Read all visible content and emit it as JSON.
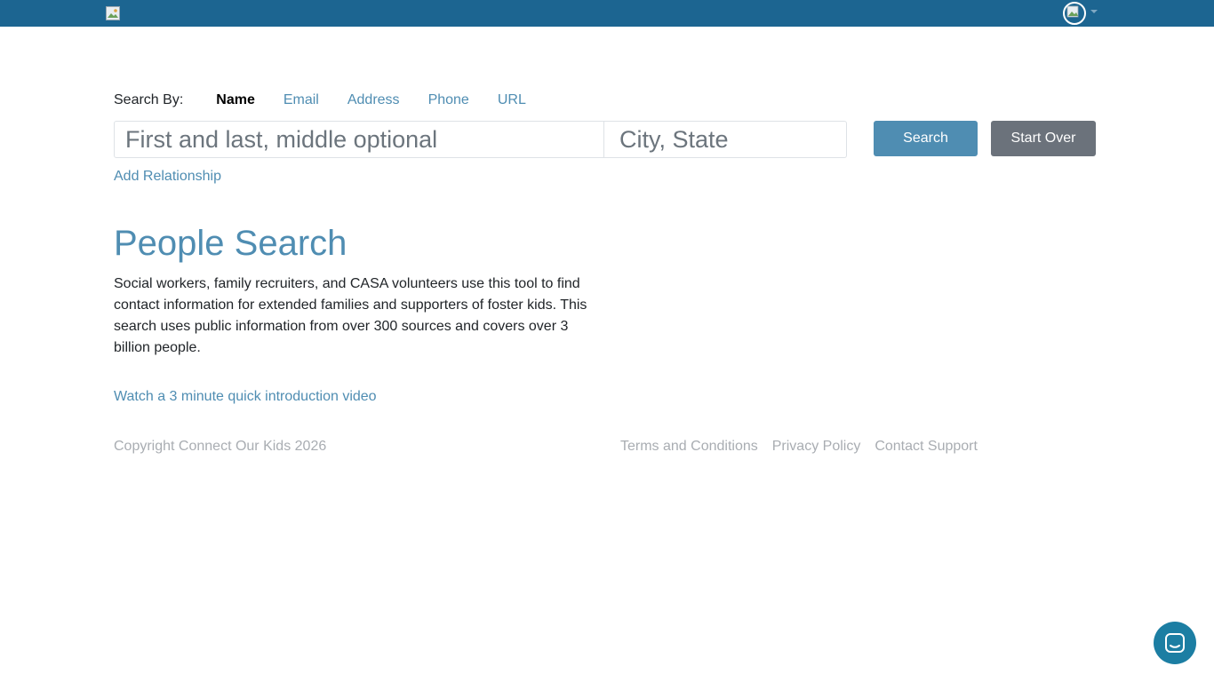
{
  "header": {
    "logo_icon": "broken-image-icon",
    "avatar_icon": "user-avatar-icon",
    "menu_caret_icon": "chevron-down-icon"
  },
  "search_by": {
    "label": "Search By:",
    "tabs": [
      {
        "label": "Name",
        "active": true
      },
      {
        "label": "Email",
        "active": false
      },
      {
        "label": "Address",
        "active": false
      },
      {
        "label": "Phone",
        "active": false
      },
      {
        "label": "URL",
        "active": false
      }
    ]
  },
  "form": {
    "name_placeholder": "First and last, middle optional",
    "name_value": "",
    "city_placeholder": "City, State",
    "city_value": "",
    "search_label": "Search",
    "start_over_label": "Start Over",
    "add_relationship_label": "Add Relationship"
  },
  "main": {
    "title": "People Search",
    "description": "Social workers, family recruiters, and CASA volunteers use this tool to find contact information for extended families and supporters of foster kids. This search uses public information from over 300 sources and covers over 3 billion people.",
    "video_link": "Watch a 3 minute quick introduction video"
  },
  "footer": {
    "copyright": "Copyright Connect Our Kids 2026",
    "links": [
      "Terms and Conditions",
      "Privacy Policy",
      "Contact Support"
    ]
  },
  "chat": {
    "icon": "chat-bubble-icon"
  },
  "colors": {
    "topbar": "#1c6591",
    "accent": "#4f8db2",
    "secondary_button": "#6b727b",
    "muted_text": "#a9adb2",
    "chat_button": "#1c7ea3"
  }
}
